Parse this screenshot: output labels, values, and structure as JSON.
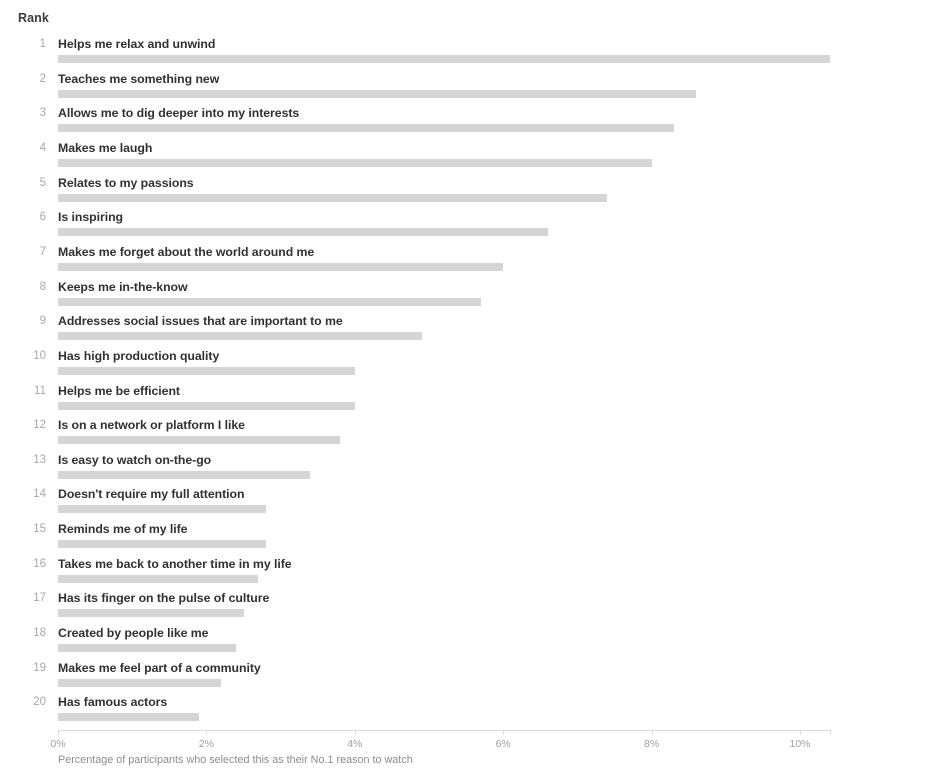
{
  "header": {
    "rank_label": "Rank"
  },
  "footer": {
    "note": "Percentage of participants who selected this as their No.1 reason to watch"
  },
  "axis": {
    "tick_labels": [
      "0%",
      "2%",
      "4%",
      "6%",
      "8%",
      "10%"
    ],
    "tick_values": [
      0,
      2,
      4,
      6,
      8,
      10
    ]
  },
  "colors": {
    "bar": "#d5d5d5",
    "label_text": "#313131",
    "rank_text": "#a8a8a8",
    "axis": "#dcdcdc",
    "footnote_text": "#8d8d8d",
    "background": "#ffffff"
  },
  "chart_data": {
    "type": "bar",
    "orientation": "horizontal",
    "title": "",
    "subtitle": "",
    "xlabel": "Percentage of participants who selected this as their No.1 reason to watch",
    "ylabel": "Rank",
    "xlim": [
      0,
      10.4
    ],
    "grid": false,
    "legend": null,
    "value_unit": "%",
    "categories": [
      "Helps me relax and unwind",
      "Teaches me something new",
      "Allows me to dig deeper into my interests",
      "Makes me laugh",
      "Relates to my passions",
      "Is inspiring",
      "Makes me forget about the world around me",
      "Keeps me in-the-know",
      "Addresses social issues that are important to me",
      "Has high production quality",
      "Helps me be efficient",
      "Is on a network or platform I like",
      "Is easy to watch on-the-go",
      "Doesn't require my full attention",
      "Reminds me of my life",
      "Takes me back to another time in my life",
      "Has its finger on the pulse of culture",
      "Created by people like me",
      "Makes me feel part of a community",
      "Has famous actors"
    ],
    "ranks": [
      1,
      2,
      3,
      4,
      5,
      6,
      7,
      8,
      9,
      10,
      11,
      12,
      13,
      14,
      15,
      16,
      17,
      18,
      19,
      20
    ],
    "values": [
      10.4,
      8.6,
      8.3,
      8.0,
      7.4,
      6.6,
      6.0,
      5.7,
      4.9,
      4.0,
      4.0,
      3.8,
      3.4,
      2.8,
      2.8,
      2.7,
      2.5,
      2.4,
      2.2,
      1.9
    ]
  }
}
